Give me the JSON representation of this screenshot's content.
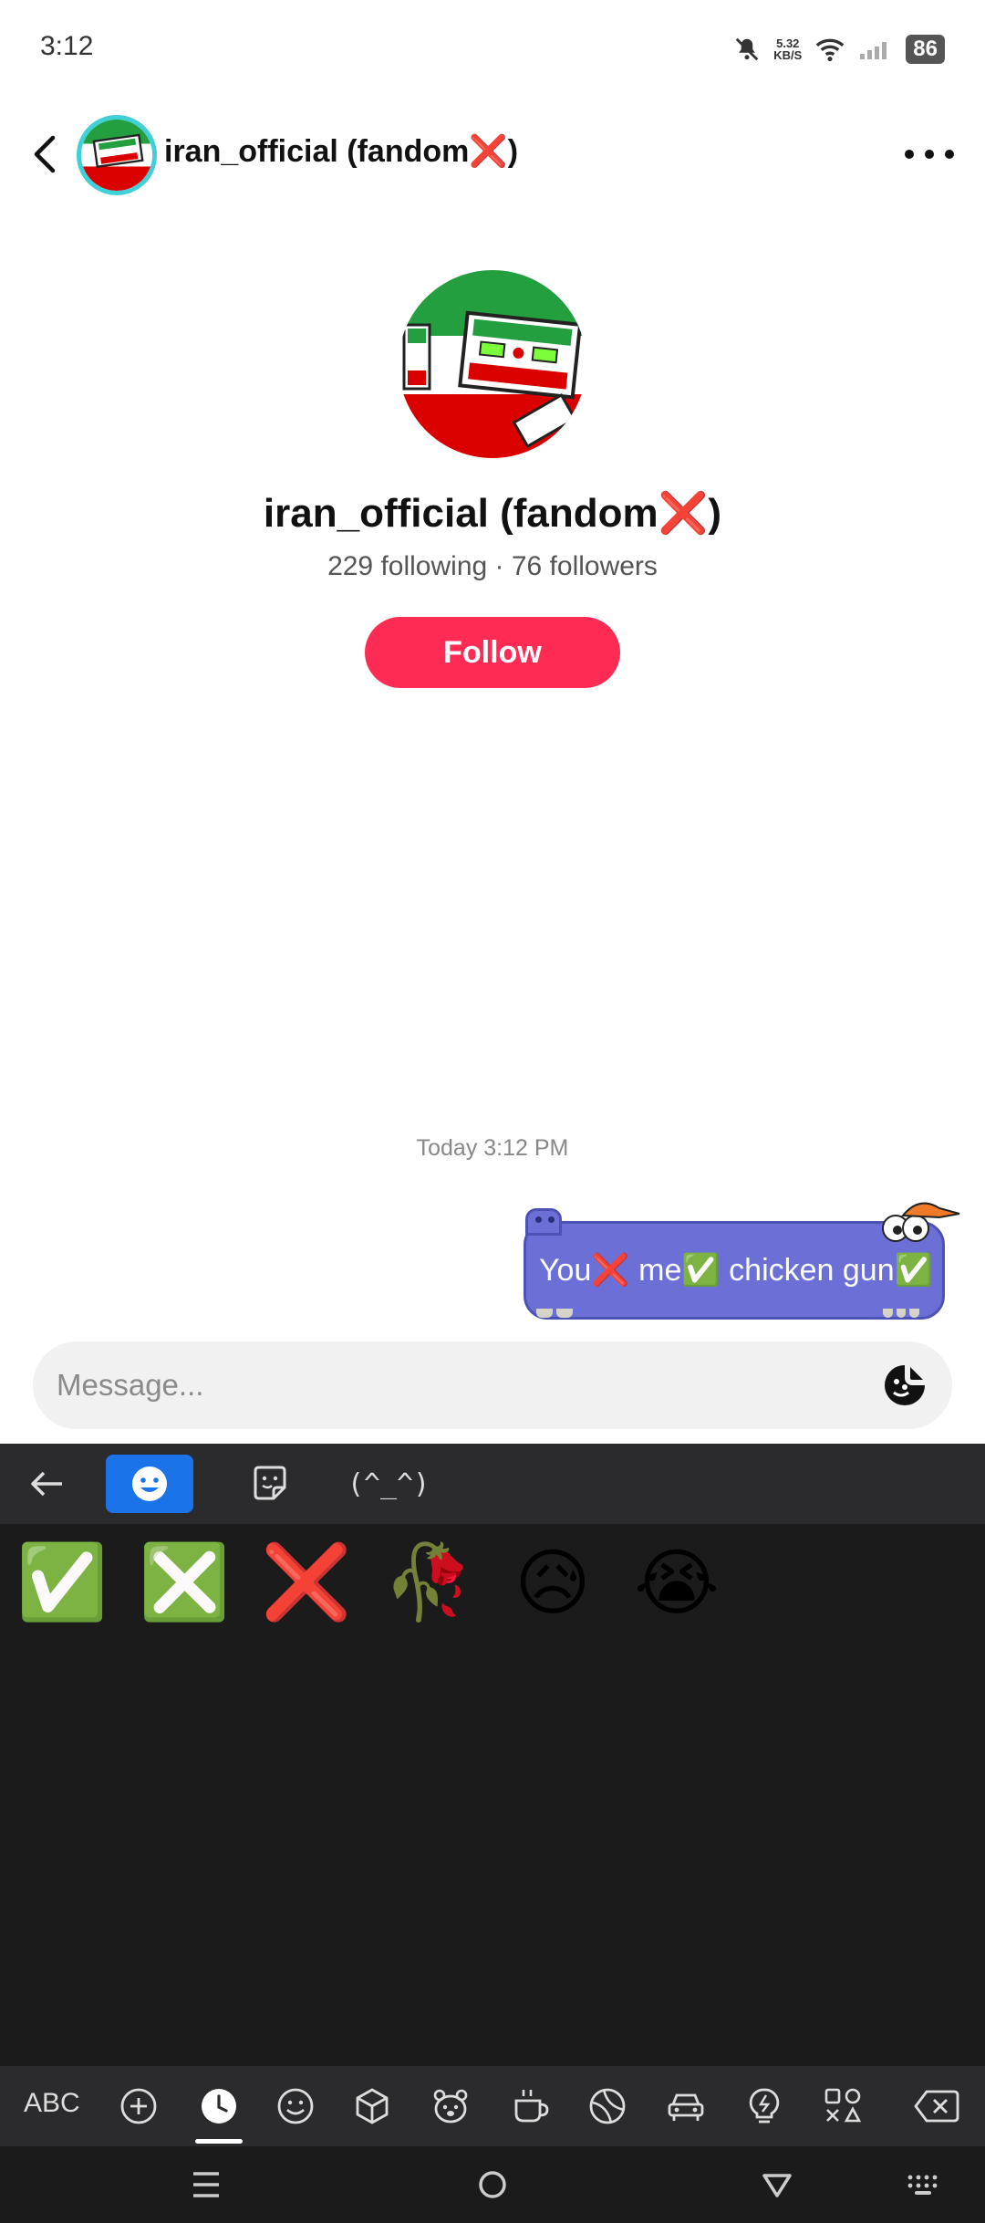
{
  "status_bar": {
    "time": "3:12",
    "net_speed_value": "5.32",
    "net_speed_unit": "KB/S",
    "battery": "86"
  },
  "header": {
    "title": "iran_official (fandom❌)"
  },
  "profile": {
    "name": "iran_official (fandom❌)",
    "stats": "229 following · 76 followers",
    "follow_label": "Follow"
  },
  "chat": {
    "timestamp": "Today 3:12 PM",
    "messages": [
      {
        "text": "You❌ me✅ chicken gun✅",
        "from": "self"
      }
    ]
  },
  "composer": {
    "placeholder": "Message..."
  },
  "keyboard": {
    "tabs": [
      "emoji-tab",
      "sticker-tab",
      "kaomoji-tab"
    ],
    "kaomoji_label": "(^_^)",
    "recent_emojis": [
      "✅",
      "❎",
      "❌",
      "🥀",
      "😥",
      "😭"
    ],
    "abc_label": "ABC",
    "categories": [
      "add-icon",
      "recent-icon",
      "smiley-icon",
      "cube-icon",
      "animal-icon",
      "food-icon",
      "sports-icon",
      "car-icon",
      "idea-icon",
      "symbols-icon",
      "backspace-icon"
    ],
    "active_category": "recent-icon"
  },
  "colors": {
    "follow": "#fe2c55",
    "bubble": "#6b6fd6",
    "keyboard_bg": "#1b1b1b",
    "keyboard_active": "#1a73e8"
  }
}
